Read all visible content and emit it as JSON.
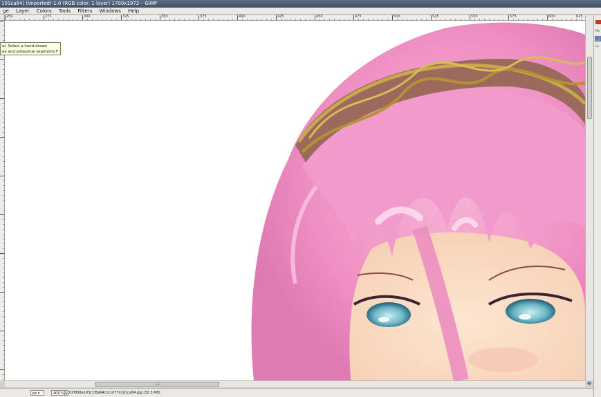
{
  "window": {
    "title": "101ca84] (imported)-1.0 (RGB color, 1 layer) 1700x1972 – GIMP"
  },
  "menu": [
    "ge",
    "Layer",
    "Colors",
    "Tools",
    "Filters",
    "Windows",
    "Help"
  ],
  "ruler": {
    "ticks": [
      "250",
      "275",
      "300",
      "325",
      "350",
      "375",
      "400",
      "425",
      "450",
      "475",
      "500",
      "525",
      "550",
      "575",
      "600",
      "625"
    ]
  },
  "tooltip": {
    "line1": "ol: Select a hand-drawn",
    "line2": "ee and polygonal segments  F"
  },
  "status": {
    "unit": "px",
    "zoom": "400 %",
    "file": "02f808e103c1f8a64c1ccd770101ca84.jpg (32.3 MB)"
  },
  "panel": {
    "labels": [
      "Mo",
      "Op",
      "Lo"
    ]
  },
  "icons": {
    "navigate": "navigate-icon",
    "dropdown": "chevron-down-icon"
  },
  "colors": {
    "hair": "#f2a1cc",
    "headband": "#c9a84a",
    "eyes": "#5aa7b8"
  }
}
